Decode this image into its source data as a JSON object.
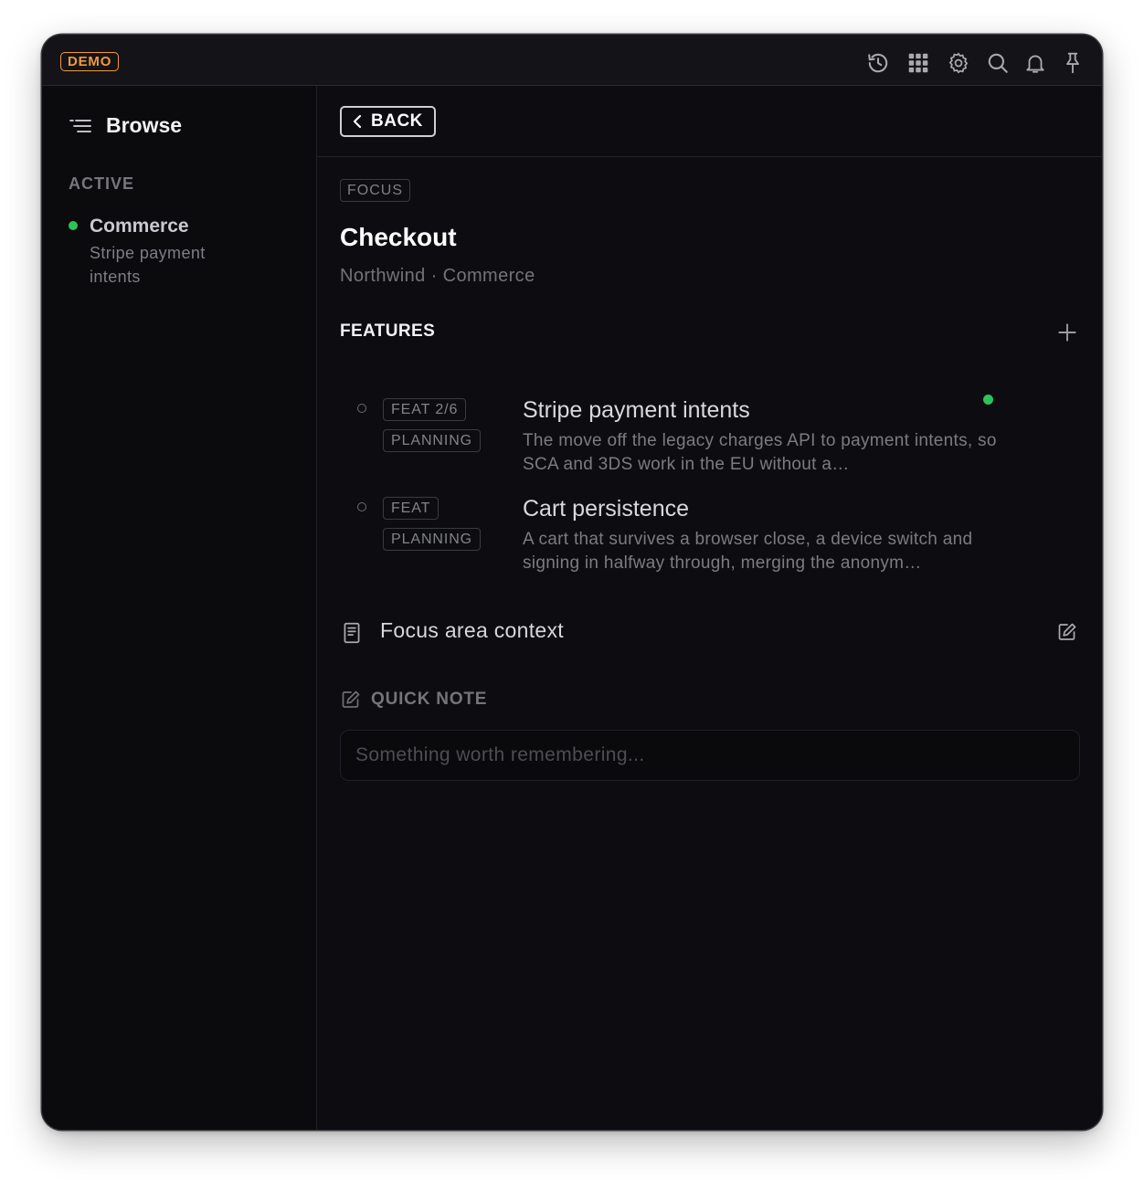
{
  "titlebar": {
    "badge": "DEMO",
    "icons": [
      "history-icon",
      "apps-grid-icon",
      "settings-gear-icon",
      "search-icon",
      "notification-bell-icon",
      "pin-icon"
    ]
  },
  "sidebar": {
    "title": "Browse",
    "section_label": "ACTIVE",
    "items": [
      {
        "title": "Commerce",
        "subtitle": "Stripe payment intents",
        "status_color": "#2fc25b"
      }
    ]
  },
  "header": {
    "back_label": "BACK"
  },
  "focus": {
    "badge": "FOCUS",
    "title": "Checkout",
    "breadcrumb": "Northwind · Commerce"
  },
  "features": {
    "heading": "FEATURES",
    "items": [
      {
        "tag": "FEAT 2/6",
        "status": "PLANNING",
        "title": "Stripe payment intents",
        "description": "The move off the legacy charges API to payment intents, so SCA and 3DS work in the EU without a…",
        "active_color": "#2fc25b"
      },
      {
        "tag": "FEAT",
        "status": "PLANNING",
        "title": "Cart persistence",
        "description": "A cart that survives a browser close, a device switch and signing in halfway through, merging the anonym…"
      }
    ]
  },
  "context": {
    "label": "Focus area context"
  },
  "quick_note": {
    "label": "QUICK NOTE",
    "placeholder": "Something worth remembering...",
    "value": ""
  },
  "colors": {
    "accent_demo": "#f29a3a",
    "active_green": "#2fc25b",
    "background": "#0d0d11"
  }
}
